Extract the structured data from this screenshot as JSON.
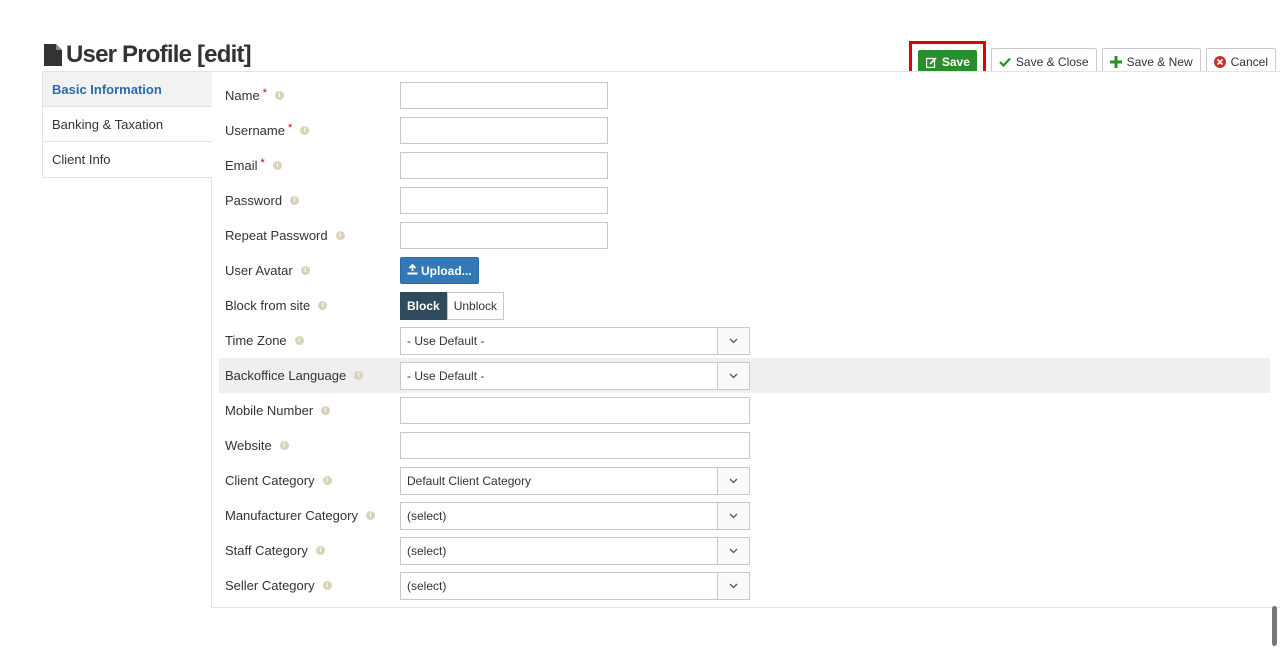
{
  "page": {
    "title": "User Profile [edit]"
  },
  "toolbar": {
    "save": "Save",
    "save_close": "Save & Close",
    "save_new": "Save & New",
    "cancel": "Cancel"
  },
  "colors": {
    "save": "#2a8f2a",
    "highlight": "#e00000",
    "upload": "#3479b7",
    "active_tab": "#2e6aa8",
    "block_on": "#2f4a5c"
  },
  "sidebar": {
    "items": [
      {
        "label": "Basic Information",
        "active": true
      },
      {
        "label": "Banking & Taxation"
      },
      {
        "label": "Client Info"
      }
    ]
  },
  "form": {
    "name": {
      "label": "Name",
      "value": ""
    },
    "username": {
      "label": "Username",
      "value": ""
    },
    "email": {
      "label": "Email",
      "value": ""
    },
    "password": {
      "label": "Password",
      "value": ""
    },
    "repeat_password": {
      "label": "Repeat Password",
      "value": ""
    },
    "avatar": {
      "label": "User Avatar",
      "button": "Upload..."
    },
    "block": {
      "label": "Block from site",
      "on": "Block",
      "off": "Unblock",
      "selected": "Block"
    },
    "timezone": {
      "label": "Time Zone",
      "value": "- Use Default -"
    },
    "backoffice_language": {
      "label": "Backoffice Language",
      "value": "- Use Default -"
    },
    "mobile": {
      "label": "Mobile Number",
      "value": ""
    },
    "website": {
      "label": "Website",
      "value": ""
    },
    "client_category": {
      "label": "Client Category",
      "value": "Default Client Category"
    },
    "manufacturer_category": {
      "label": "Manufacturer Category",
      "value": "(select)"
    },
    "staff_category": {
      "label": "Staff Category",
      "value": "(select)"
    },
    "seller_category": {
      "label": "Seller Category",
      "value": "(select)"
    }
  },
  "required_marker": "*",
  "info_marker": "i"
}
